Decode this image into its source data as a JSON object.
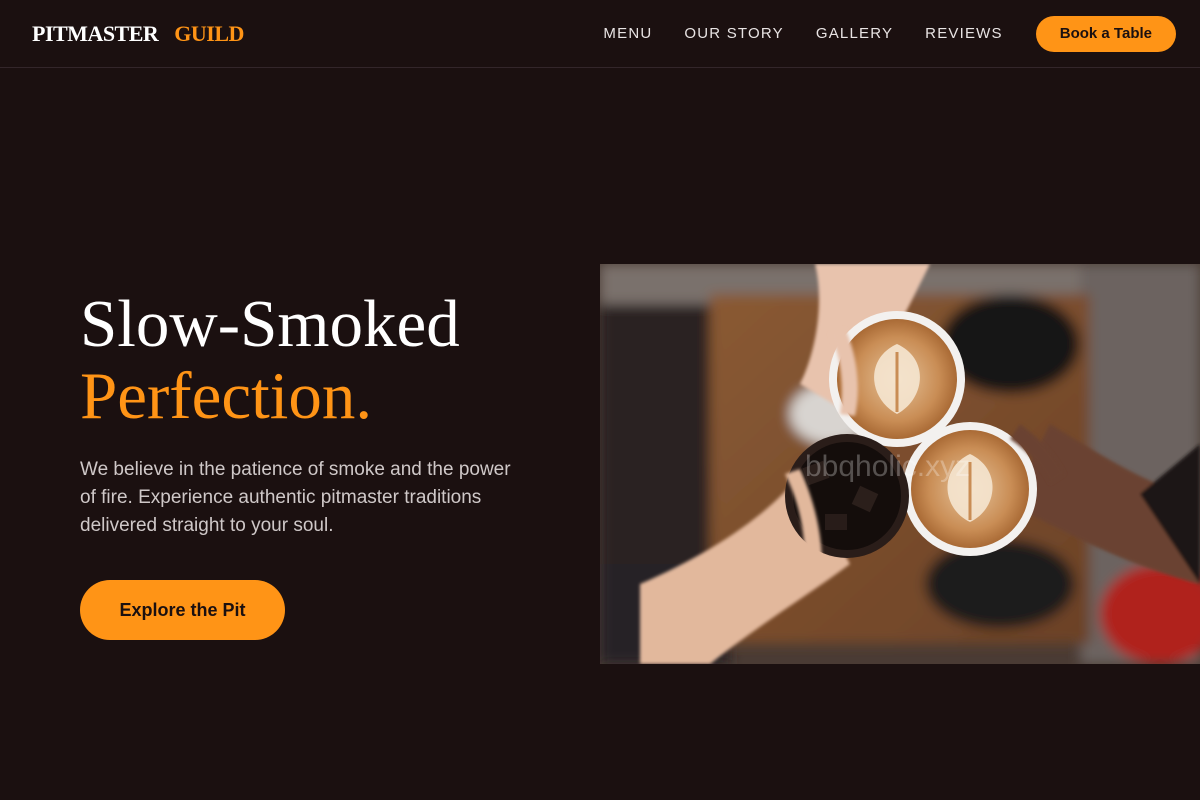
{
  "header": {
    "logo_word1": "PITMASTER",
    "logo_word2": "GUILD",
    "nav": [
      "MENU",
      "OUR STORY",
      "GALLERY",
      "REVIEWS"
    ],
    "cta_label": "Book a Table"
  },
  "hero": {
    "title_line1": "Slow-Smoked",
    "title_line2": "Perfection.",
    "description": "We believe in the patience of smoke and the power of fire. Experience authentic pitmaster traditions delivered straight to your soul.",
    "cta_label": "Explore the Pit"
  },
  "image": {
    "watermark": "bbqholic.xyz"
  },
  "colors": {
    "background": "#1b1010",
    "accent": "#ff9416",
    "text_muted": "#cfc8c8"
  }
}
